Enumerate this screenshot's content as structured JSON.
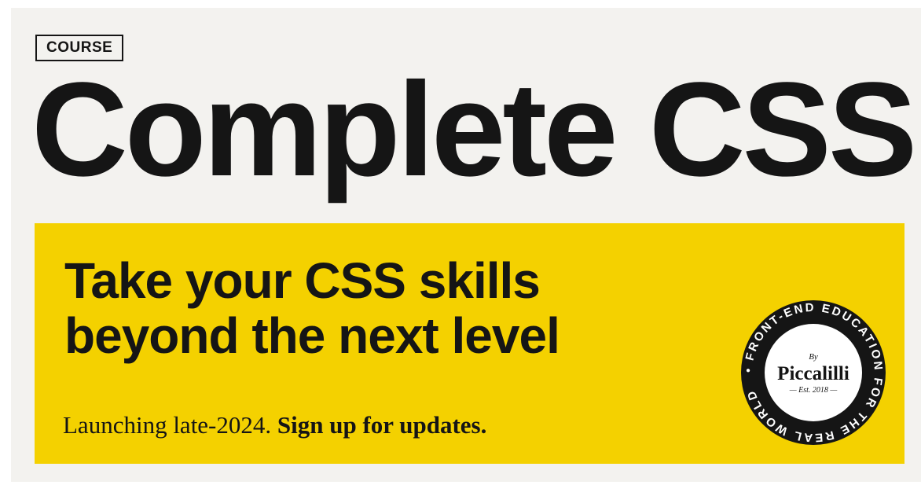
{
  "badge": "COURSE",
  "title": "Complete CSS",
  "promo": {
    "headline_line1": "Take your CSS skills",
    "headline_line2": "beyond the next level",
    "launch_text": "Launching late-2024.",
    "signup_link": "Sign up for updates.",
    "background_color": "#f4d100"
  },
  "logo": {
    "ring_text": "• FRONT-END EDUCATION FOR THE REAL WORLD",
    "by": "By",
    "name": "Piccalilli",
    "est": "— Est. 2018 —"
  }
}
